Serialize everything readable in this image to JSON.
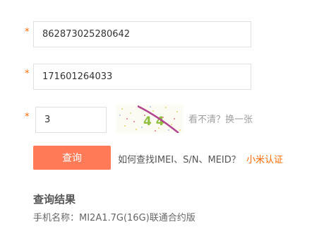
{
  "form": {
    "required_marker": "*",
    "imei_value": "862873025280642",
    "sn_value": "171601264033",
    "captcha_input_value": "3",
    "captcha_image_text": "4 4",
    "refresh_captcha_label": "看不清？换一张",
    "query_button_label": "查询",
    "help_text": "如何查找IMEI、S/N、MEID？",
    "verify_link_label": "小米认证"
  },
  "result": {
    "title": "查询结果",
    "phone_name": "手机名称：MI2A1.7G(16G)联通合约版"
  },
  "colors": {
    "accent": "#ff6a00",
    "button": "#ff7a57"
  },
  "icons": [
    "captcha-image"
  ]
}
